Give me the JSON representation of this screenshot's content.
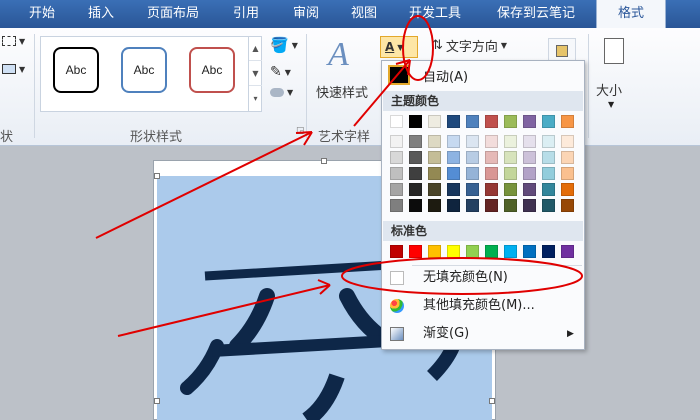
{
  "tabs": [
    "开始",
    "插入",
    "页面布局",
    "引用",
    "审阅",
    "视图",
    "开发工具",
    "保存到云笔记",
    "格式"
  ],
  "ribbon": {
    "left_group_fragment": "状",
    "shape_styles_label": "形状样式",
    "abc_label": "Abc",
    "wordart_label": "艺术字样",
    "quick_styles_label": "快速样式",
    "text_direction_label": "文字方向",
    "size_label": "大小",
    "shape_outline_colors": [
      "#000000",
      "#4f81bd",
      "#c0504d"
    ]
  },
  "document": {
    "shape_fill": "#abcaeb",
    "glyph": "乎"
  },
  "menu": {
    "auto_label": "自动(A)",
    "theme_colors_title": "主题颜色",
    "standard_colors_title": "标准色",
    "no_fill_label": "无填充颜色(N)",
    "more_fill_label": "其他填充颜色(M)...",
    "gradient_label": "渐变(G)",
    "theme_rows": [
      [
        "#ffffff",
        "#000000",
        "#eeece1",
        "#1f497d",
        "#4f81bd",
        "#c0504d",
        "#9bbb59",
        "#8064a2",
        "#4bacc6",
        "#f79646"
      ],
      [
        "#f2f2f2",
        "#7f7f7f",
        "#ddd9c3",
        "#c6d9f0",
        "#dbe5f1",
        "#f2dcdb",
        "#ebf1dd",
        "#e5e0ec",
        "#dbeef3",
        "#fdeada"
      ],
      [
        "#d8d8d8",
        "#595959",
        "#c4bd97",
        "#8db3e2",
        "#b8cce4",
        "#e5b9b7",
        "#d7e3bc",
        "#ccc1d9",
        "#b7dde8",
        "#fbd5b5"
      ],
      [
        "#bfbfbf",
        "#3f3f3f",
        "#938953",
        "#548dd4",
        "#95b3d7",
        "#d99694",
        "#c3d69b",
        "#b2a2c7",
        "#92cddc",
        "#fac08f"
      ],
      [
        "#a5a5a5",
        "#262626",
        "#494429",
        "#17365d",
        "#366092",
        "#953734",
        "#76923c",
        "#5f497a",
        "#31859b",
        "#e36c09"
      ],
      [
        "#7f7f7f",
        "#0c0c0c",
        "#1d1b10",
        "#0f243e",
        "#244061",
        "#632423",
        "#4f6128",
        "#3f3151",
        "#205867",
        "#974806"
      ]
    ],
    "standard_colors": [
      "#c00000",
      "#ff0000",
      "#ffc000",
      "#ffff00",
      "#92d050",
      "#00b050",
      "#00b0f0",
      "#0070c0",
      "#002060",
      "#7030a0"
    ]
  },
  "annotation_color": "#e00000"
}
